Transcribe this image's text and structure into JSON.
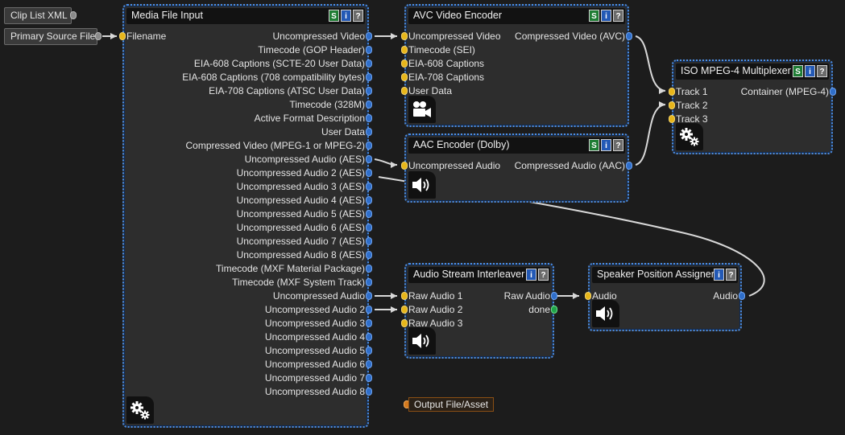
{
  "external_inputs": [
    {
      "label": "Clip List XML"
    },
    {
      "label": "Primary Source File"
    }
  ],
  "nodes": {
    "media_file_input": {
      "title": "Media File Input",
      "badges": [
        "S",
        "i",
        "?"
      ],
      "inputs": [
        "Filename"
      ],
      "outputs": [
        "Uncompressed Video",
        "Timecode (GOP Header)",
        "EIA-608 Captions (SCTE-20 User Data)",
        "EIA-608 Captions (708 compatibility bytes)",
        "EIA-708 Captions (ATSC User Data)",
        "Timecode (328M)",
        "Active Format Description",
        "User Data",
        "Compressed Video (MPEG-1 or MPEG-2)",
        "Uncompressed Audio (AES)",
        "Uncompressed Audio 2 (AES)",
        "Uncompressed Audio 3 (AES)",
        "Uncompressed Audio 4 (AES)",
        "Uncompressed Audio 5 (AES)",
        "Uncompressed Audio 6 (AES)",
        "Uncompressed Audio 7 (AES)",
        "Uncompressed Audio 8 (AES)",
        "Timecode (MXF Material Package)",
        "Timecode (MXF System Track)",
        "Uncompressed Audio",
        "Uncompressed Audio 2",
        "Uncompressed Audio 3",
        "Uncompressed Audio 4",
        "Uncompressed Audio 5",
        "Uncompressed Audio 6",
        "Uncompressed Audio 7",
        "Uncompressed Audio 8"
      ],
      "tab_icon": "gears-icon"
    },
    "avc_video_encoder": {
      "title": "AVC Video Encoder",
      "badges": [
        "S",
        "i",
        "?"
      ],
      "inputs": [
        "Uncompressed Video",
        "Timecode (SEI)",
        "EIA-608 Captions",
        "EIA-708 Captions",
        "User Data"
      ],
      "outputs": [
        "Compressed Video (AVC)"
      ],
      "tab_icon": "video-camera-icon"
    },
    "aac_encoder": {
      "title": "AAC Encoder (Dolby)",
      "badges": [
        "S",
        "i",
        "?"
      ],
      "inputs": [
        "Uncompressed Audio"
      ],
      "outputs": [
        "Compressed Audio (AAC)"
      ],
      "tab_icon": "speaker-icon"
    },
    "iso_mp4_mux": {
      "title": "ISO MPEG-4 Multiplexer",
      "badges": [
        "S",
        "i",
        "?"
      ],
      "inputs": [
        "Track 1",
        "Track 2",
        "Track 3"
      ],
      "outputs": [
        "Container (MPEG-4)"
      ],
      "tab_icon": "gears-icon"
    },
    "audio_stream_interleaver": {
      "title": "Audio Stream Interleaver",
      "badges": [
        "i",
        "?"
      ],
      "inputs": [
        "Raw Audio 1",
        "Raw Audio 2",
        "Raw Audio 3"
      ],
      "outputs": [
        "Raw Audio",
        "done"
      ],
      "tab_icon": "speaker-icon"
    },
    "speaker_position_assigner": {
      "title": "Speaker Position Assigner",
      "badges": [
        "i",
        "?"
      ],
      "inputs": [
        "Audio"
      ],
      "outputs": [
        "Audio"
      ],
      "tab_icon": "speaker-icon"
    }
  },
  "output_asset": {
    "label": "Output File/Asset"
  },
  "colors": {
    "node_border": "#4a8ee8",
    "input_port": "#e7b61a",
    "output_port": "#2f6ec9",
    "done_port": "#20a34a",
    "wire": "#d8d8d8"
  }
}
